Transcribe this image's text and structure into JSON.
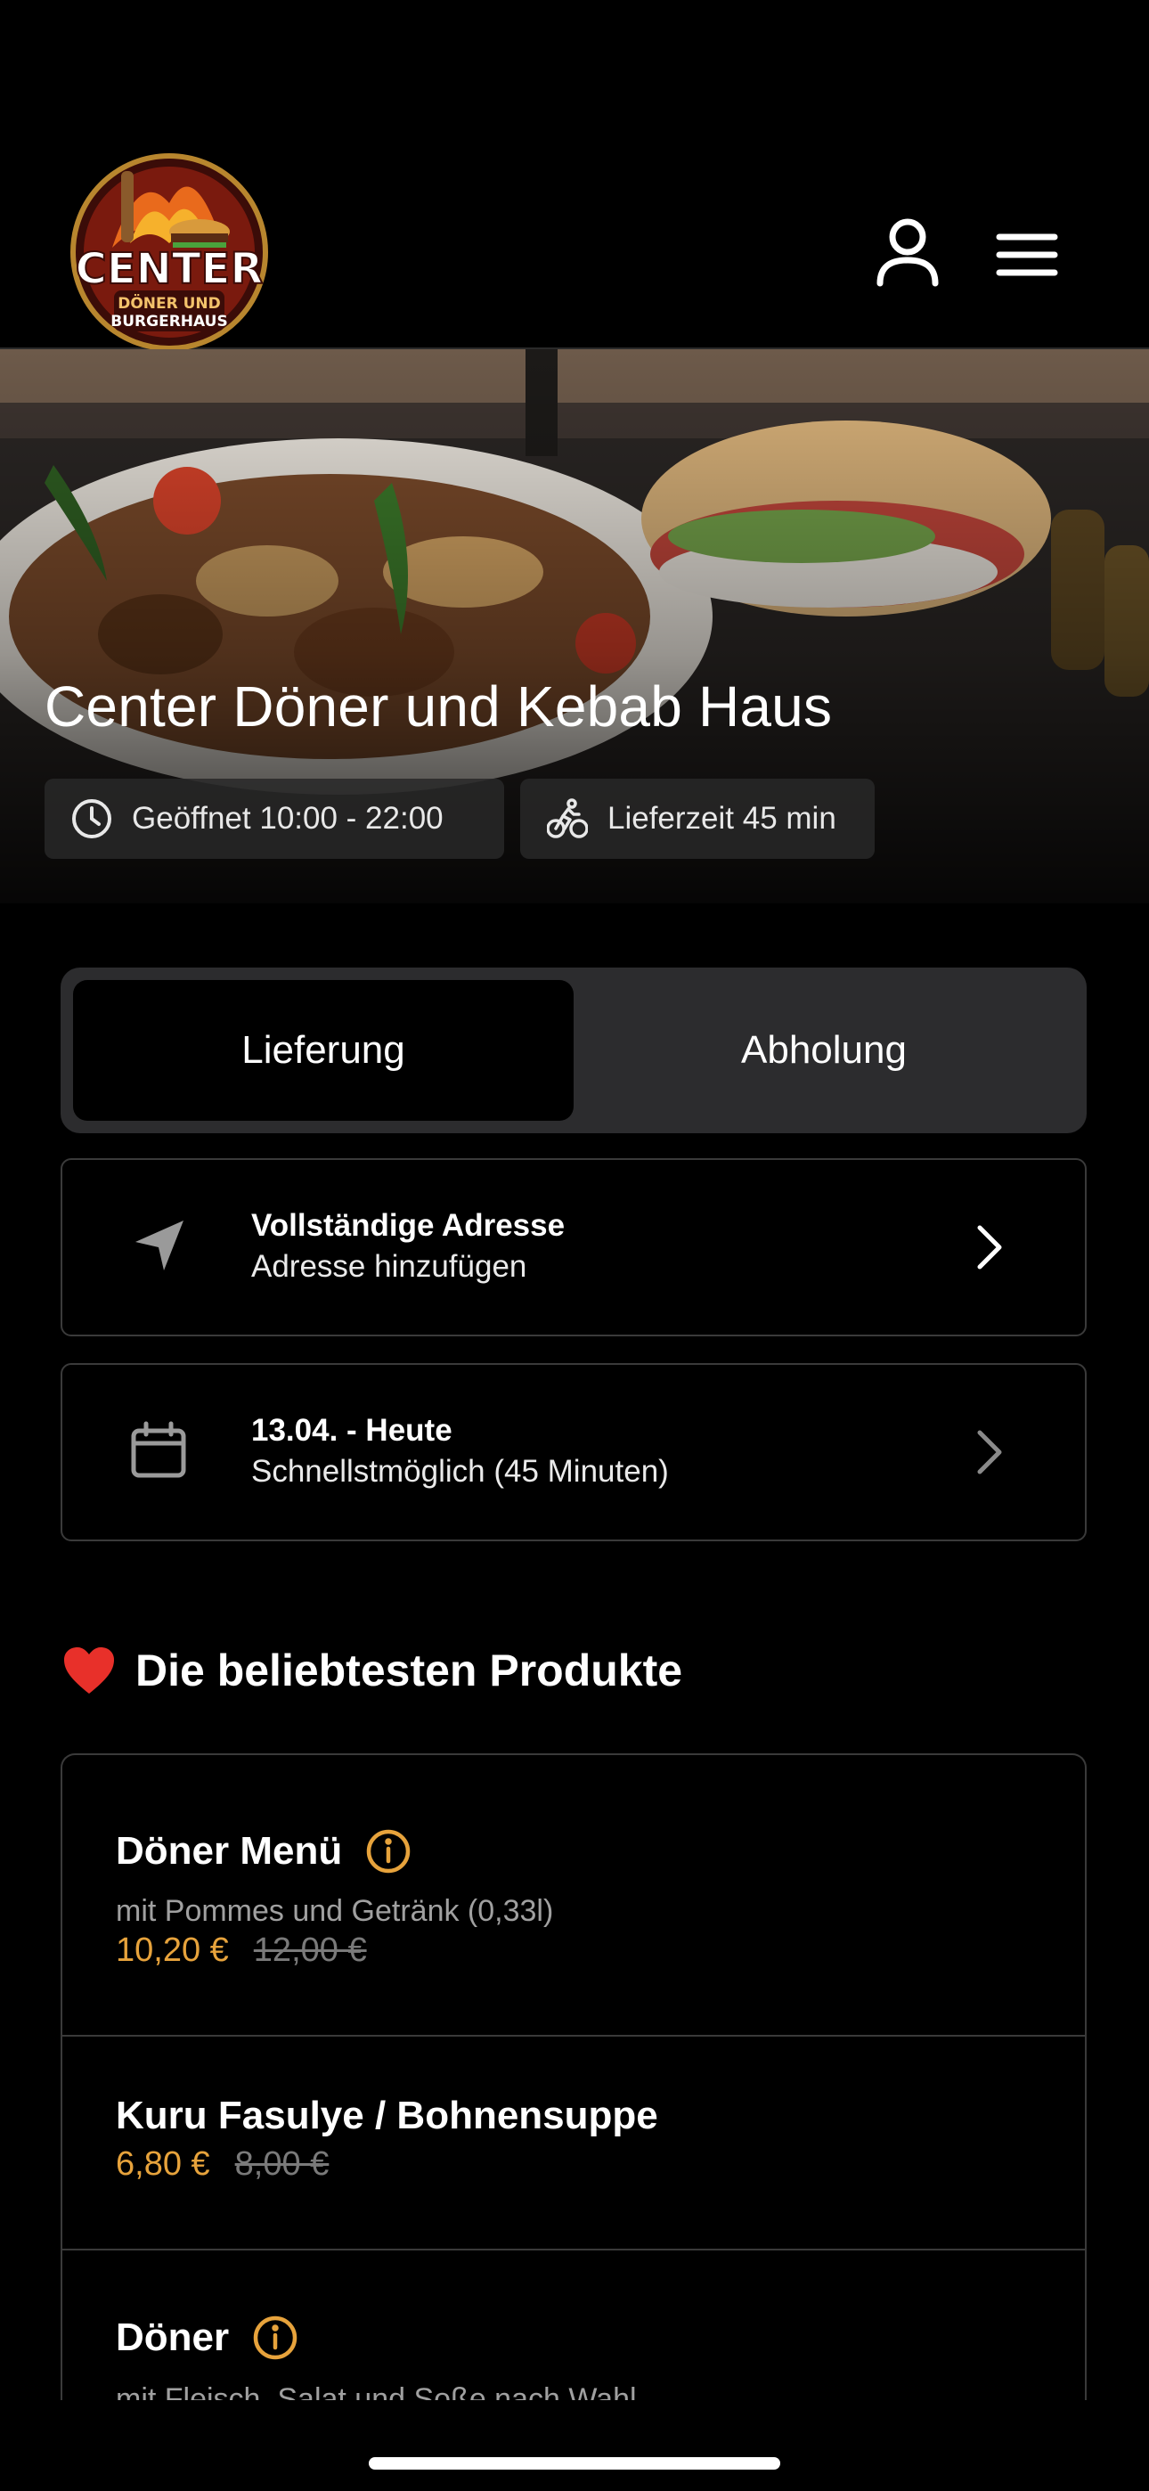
{
  "header": {
    "logo": {
      "brand": "CENTER",
      "tagline_1": "DÖNER UND",
      "tagline_2": "BURGERHAUS"
    },
    "icons": [
      "user-icon",
      "menu-icon"
    ]
  },
  "hero": {
    "title": "Center Döner und Kebab Haus",
    "opening_hours": "Geöffnet 10:00 - 22:00",
    "delivery_time": "Lieferzeit 45 min"
  },
  "order_mode": {
    "options": [
      "Lieferung",
      "Abholung"
    ],
    "selected": "Lieferung"
  },
  "address": {
    "title": "Vollständige Adresse",
    "subtitle": "Adresse hinzufügen"
  },
  "schedule": {
    "title": "13.04. - Heute",
    "subtitle": "Schnellstmöglich (45 Minuten)"
  },
  "popular": {
    "title": "Die beliebtesten Produkte",
    "products": [
      {
        "name": "Döner Menü",
        "description": "mit Pommes und Getränk (0,33l)",
        "price": "10,20 €",
        "old_price": "12,00 €",
        "has_info": true
      },
      {
        "name": "Kuru Fasulye / Bohnensuppe",
        "price": "6,80 €",
        "old_price": "8,00 €",
        "has_info": false
      },
      {
        "name": "Döner",
        "description": "mit Fleisch, Salat und Soße nach Wahl",
        "has_info": true
      }
    ]
  },
  "colors": {
    "accent": "#E7A33C",
    "background": "#000000",
    "card_border": "#3A3A3A",
    "toggle_bg": "#2C2C2E"
  }
}
